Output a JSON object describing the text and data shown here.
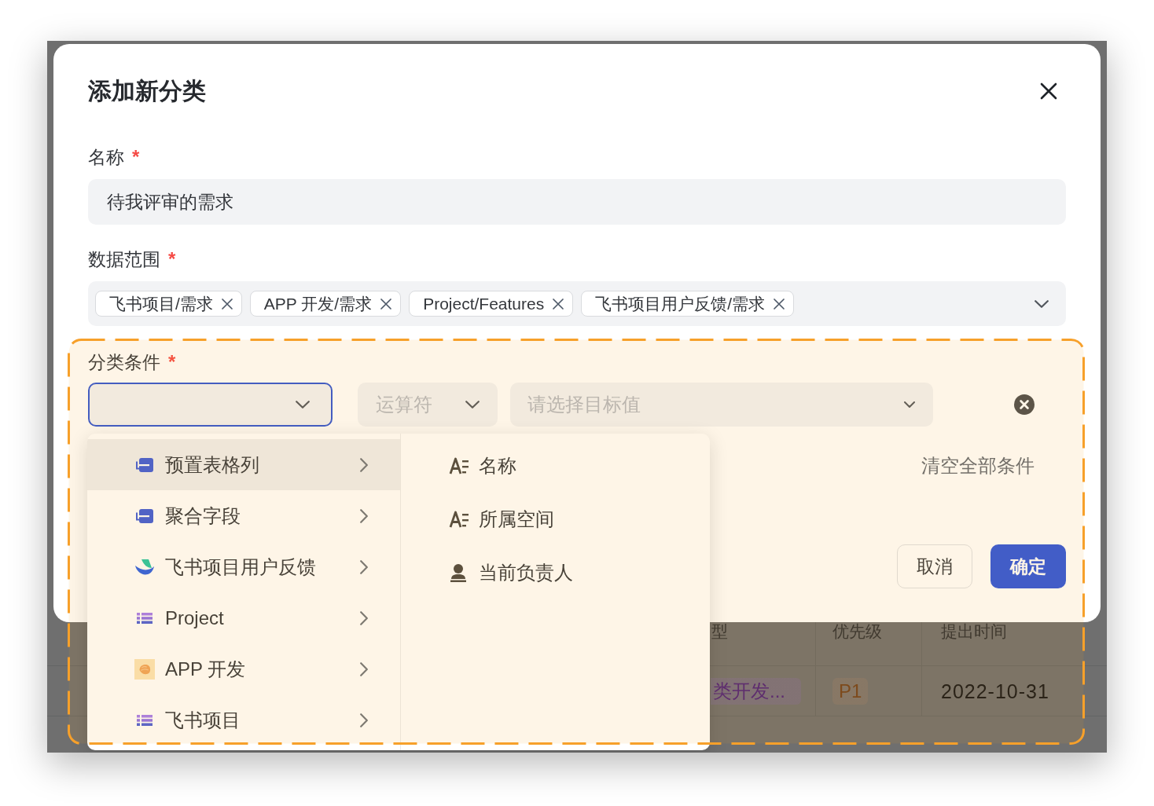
{
  "background_table": {
    "columns": [
      {
        "label": "型"
      },
      {
        "label": "优先级"
      },
      {
        "label": "提出时间"
      }
    ],
    "rows": [
      {
        "cells": [
          {
            "kind": "tag",
            "text": "类开发...",
            "color": "#5e2d6e"
          },
          {
            "kind": "tag",
            "text": "P1",
            "color": "#7d4a1c"
          },
          {
            "kind": "text",
            "text": "2022-10-31"
          }
        ]
      }
    ]
  },
  "dialog": {
    "title": "添加新分类",
    "fields": [
      {
        "kind": "text",
        "label": "名称",
        "required_mark": "*",
        "value": "待我评审的需求"
      },
      {
        "kind": "multi_select",
        "label": "数据范围",
        "required_mark": "*",
        "tags": [
          "飞书项目/需求",
          "APP 开发/需求",
          "Project/Features",
          "飞书项目用户反馈/需求"
        ]
      }
    ],
    "conditions": {
      "label": "分类条件",
      "required_mark": "*",
      "rows": [
        {
          "field": {
            "open": true,
            "menu": {
              "columns": [
                {
                  "items": [
                    {
                      "kind": "field_group",
                      "label": "预置表格列",
                      "selected": true,
                      "submenu": true
                    },
                    {
                      "kind": "field_group",
                      "label": "聚合字段",
                      "selected": false,
                      "submenu": true
                    },
                    {
                      "kind": "logo_space",
                      "label": "飞书项目用户反馈",
                      "selected": false,
                      "submenu": true
                    },
                    {
                      "kind": "list_space",
                      "label": "Project",
                      "selected": false,
                      "submenu": true
                    },
                    {
                      "kind": "emoji_space",
                      "label": "APP 开发",
                      "selected": false,
                      "submenu": true
                    },
                    {
                      "kind": "list_space",
                      "label": "飞书项目",
                      "selected": false,
                      "submenu": true
                    }
                  ]
                },
                {
                  "items": [
                    {
                      "kind": "text",
                      "label": "名称",
                      "selected": false
                    },
                    {
                      "kind": "text",
                      "label": "所属空间",
                      "selected": false
                    },
                    {
                      "kind": "user",
                      "label": "当前负责人",
                      "selected": false
                    }
                  ]
                }
              ]
            }
          },
          "operator": {
            "placeholder": "运算符"
          },
          "target": {
            "placeholder": "请选择目标值"
          }
        }
      ],
      "clear_all": "清空全部条件"
    },
    "buttons": [
      {
        "kind": "outline",
        "label": "取消"
      },
      {
        "kind": "primary",
        "label": "确定"
      }
    ]
  },
  "annotation": {
    "kind": "dashed_box"
  }
}
